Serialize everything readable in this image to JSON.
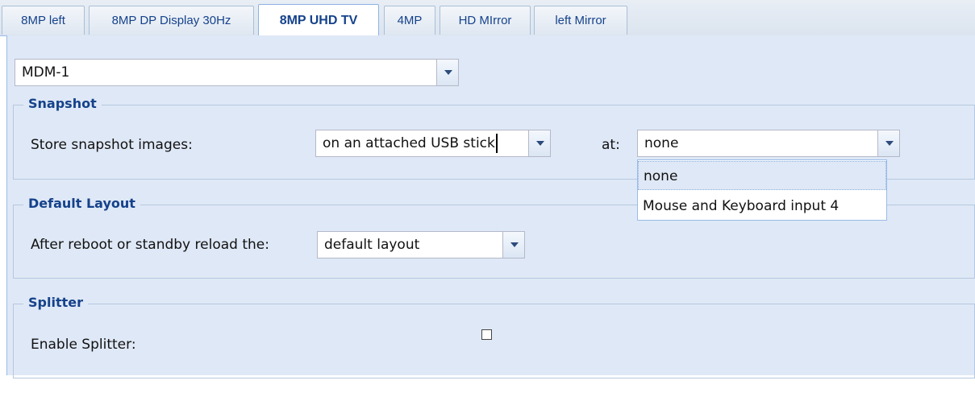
{
  "tabs": [
    {
      "label": "8MP left"
    },
    {
      "label": "8MP DP Display 30Hz"
    },
    {
      "label": "8MP UHD TV"
    },
    {
      "label": "4MP"
    },
    {
      "label": "HD MIrror"
    },
    {
      "label": "left Mirror"
    }
  ],
  "device_select": {
    "value": "MDM-1"
  },
  "snapshot": {
    "legend": "Snapshot",
    "store_label": "Store snapshot images:",
    "store_value": "on an attached USB stick",
    "at_label": "at:",
    "at_value": "none",
    "at_options": [
      "none",
      "Mouse and Keyboard input 4"
    ]
  },
  "default_layout": {
    "legend": "Default Layout",
    "reload_label": "After reboot or standby reload the:",
    "reload_value": "default layout"
  },
  "splitter": {
    "legend": "Splitter",
    "enable_label": "Enable Splitter:",
    "enabled": false
  }
}
